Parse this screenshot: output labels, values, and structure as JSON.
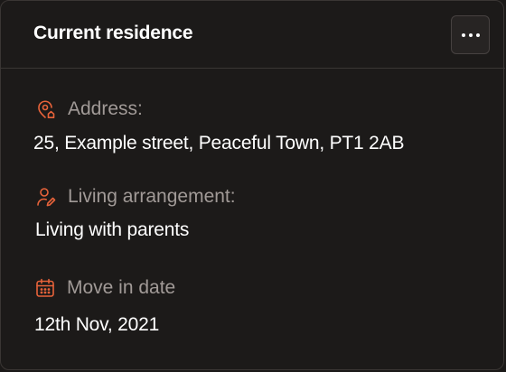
{
  "card": {
    "title": "Current residence",
    "more_icon": "more-horizontal-icon"
  },
  "fields": [
    {
      "icon": "map-pin-home-icon",
      "label": "Address:",
      "value": "25, Example street, Peaceful Town, PT1 2AB"
    },
    {
      "icon": "user-edit-icon",
      "label": "Living arrangement:",
      "value": "Living with parents"
    },
    {
      "icon": "calendar-icon",
      "label": "Move in date",
      "value": "12th Nov, 2021"
    }
  ],
  "colors": {
    "accent": "#e8633a",
    "background": "#1c1a19",
    "label": "#a19a97",
    "value": "#ffffff"
  }
}
